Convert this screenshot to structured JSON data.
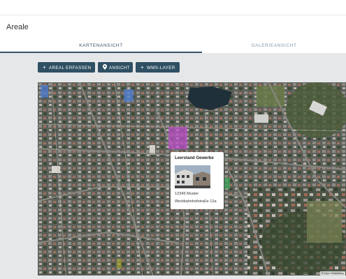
{
  "page": {
    "title": "Areale"
  },
  "tabs": [
    {
      "label": "KARTENANSICHT",
      "active": true
    },
    {
      "label": "GALERIEANSICHT",
      "active": false
    }
  ],
  "toolbar": {
    "areal_label": "AREAL ERFASSEN",
    "ansicht_label": "ANSICHT",
    "wms_label": "WMS-LAYER"
  },
  "map": {
    "popup": {
      "title": "Leerstand Gewerbe",
      "zip_city": "12345 Muster",
      "street": "Westbahnhofstraße 12a"
    },
    "attribution": "© OpenStreetMap"
  },
  "colors": {
    "primary": "#2f5063",
    "area_blue": "#4f7fd6",
    "area_magenta": "#c24fd0",
    "area_green": "#3fa05a"
  }
}
